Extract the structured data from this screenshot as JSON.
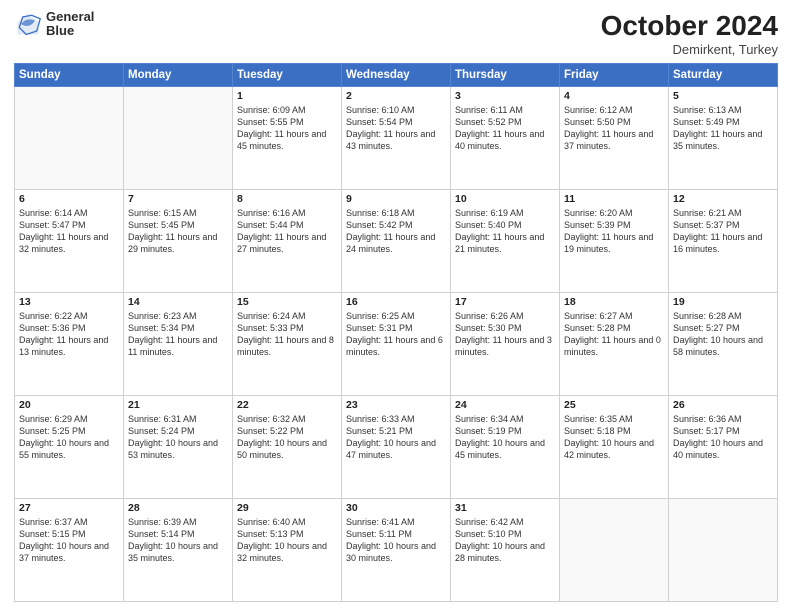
{
  "header": {
    "logo_line1": "General",
    "logo_line2": "Blue",
    "month": "October 2024",
    "location": "Demirkent, Turkey"
  },
  "weekdays": [
    "Sunday",
    "Monday",
    "Tuesday",
    "Wednesday",
    "Thursday",
    "Friday",
    "Saturday"
  ],
  "weeks": [
    [
      {
        "day": "",
        "info": ""
      },
      {
        "day": "",
        "info": ""
      },
      {
        "day": "1",
        "info": "Sunrise: 6:09 AM\nSunset: 5:55 PM\nDaylight: 11 hours and 45 minutes."
      },
      {
        "day": "2",
        "info": "Sunrise: 6:10 AM\nSunset: 5:54 PM\nDaylight: 11 hours and 43 minutes."
      },
      {
        "day": "3",
        "info": "Sunrise: 6:11 AM\nSunset: 5:52 PM\nDaylight: 11 hours and 40 minutes."
      },
      {
        "day": "4",
        "info": "Sunrise: 6:12 AM\nSunset: 5:50 PM\nDaylight: 11 hours and 37 minutes."
      },
      {
        "day": "5",
        "info": "Sunrise: 6:13 AM\nSunset: 5:49 PM\nDaylight: 11 hours and 35 minutes."
      }
    ],
    [
      {
        "day": "6",
        "info": "Sunrise: 6:14 AM\nSunset: 5:47 PM\nDaylight: 11 hours and 32 minutes."
      },
      {
        "day": "7",
        "info": "Sunrise: 6:15 AM\nSunset: 5:45 PM\nDaylight: 11 hours and 29 minutes."
      },
      {
        "day": "8",
        "info": "Sunrise: 6:16 AM\nSunset: 5:44 PM\nDaylight: 11 hours and 27 minutes."
      },
      {
        "day": "9",
        "info": "Sunrise: 6:18 AM\nSunset: 5:42 PM\nDaylight: 11 hours and 24 minutes."
      },
      {
        "day": "10",
        "info": "Sunrise: 6:19 AM\nSunset: 5:40 PM\nDaylight: 11 hours and 21 minutes."
      },
      {
        "day": "11",
        "info": "Sunrise: 6:20 AM\nSunset: 5:39 PM\nDaylight: 11 hours and 19 minutes."
      },
      {
        "day": "12",
        "info": "Sunrise: 6:21 AM\nSunset: 5:37 PM\nDaylight: 11 hours and 16 minutes."
      }
    ],
    [
      {
        "day": "13",
        "info": "Sunrise: 6:22 AM\nSunset: 5:36 PM\nDaylight: 11 hours and 13 minutes."
      },
      {
        "day": "14",
        "info": "Sunrise: 6:23 AM\nSunset: 5:34 PM\nDaylight: 11 hours and 11 minutes."
      },
      {
        "day": "15",
        "info": "Sunrise: 6:24 AM\nSunset: 5:33 PM\nDaylight: 11 hours and 8 minutes."
      },
      {
        "day": "16",
        "info": "Sunrise: 6:25 AM\nSunset: 5:31 PM\nDaylight: 11 hours and 6 minutes."
      },
      {
        "day": "17",
        "info": "Sunrise: 6:26 AM\nSunset: 5:30 PM\nDaylight: 11 hours and 3 minutes."
      },
      {
        "day": "18",
        "info": "Sunrise: 6:27 AM\nSunset: 5:28 PM\nDaylight: 11 hours and 0 minutes."
      },
      {
        "day": "19",
        "info": "Sunrise: 6:28 AM\nSunset: 5:27 PM\nDaylight: 10 hours and 58 minutes."
      }
    ],
    [
      {
        "day": "20",
        "info": "Sunrise: 6:29 AM\nSunset: 5:25 PM\nDaylight: 10 hours and 55 minutes."
      },
      {
        "day": "21",
        "info": "Sunrise: 6:31 AM\nSunset: 5:24 PM\nDaylight: 10 hours and 53 minutes."
      },
      {
        "day": "22",
        "info": "Sunrise: 6:32 AM\nSunset: 5:22 PM\nDaylight: 10 hours and 50 minutes."
      },
      {
        "day": "23",
        "info": "Sunrise: 6:33 AM\nSunset: 5:21 PM\nDaylight: 10 hours and 47 minutes."
      },
      {
        "day": "24",
        "info": "Sunrise: 6:34 AM\nSunset: 5:19 PM\nDaylight: 10 hours and 45 minutes."
      },
      {
        "day": "25",
        "info": "Sunrise: 6:35 AM\nSunset: 5:18 PM\nDaylight: 10 hours and 42 minutes."
      },
      {
        "day": "26",
        "info": "Sunrise: 6:36 AM\nSunset: 5:17 PM\nDaylight: 10 hours and 40 minutes."
      }
    ],
    [
      {
        "day": "27",
        "info": "Sunrise: 6:37 AM\nSunset: 5:15 PM\nDaylight: 10 hours and 37 minutes."
      },
      {
        "day": "28",
        "info": "Sunrise: 6:39 AM\nSunset: 5:14 PM\nDaylight: 10 hours and 35 minutes."
      },
      {
        "day": "29",
        "info": "Sunrise: 6:40 AM\nSunset: 5:13 PM\nDaylight: 10 hours and 32 minutes."
      },
      {
        "day": "30",
        "info": "Sunrise: 6:41 AM\nSunset: 5:11 PM\nDaylight: 10 hours and 30 minutes."
      },
      {
        "day": "31",
        "info": "Sunrise: 6:42 AM\nSunset: 5:10 PM\nDaylight: 10 hours and 28 minutes."
      },
      {
        "day": "",
        "info": ""
      },
      {
        "day": "",
        "info": ""
      }
    ]
  ]
}
